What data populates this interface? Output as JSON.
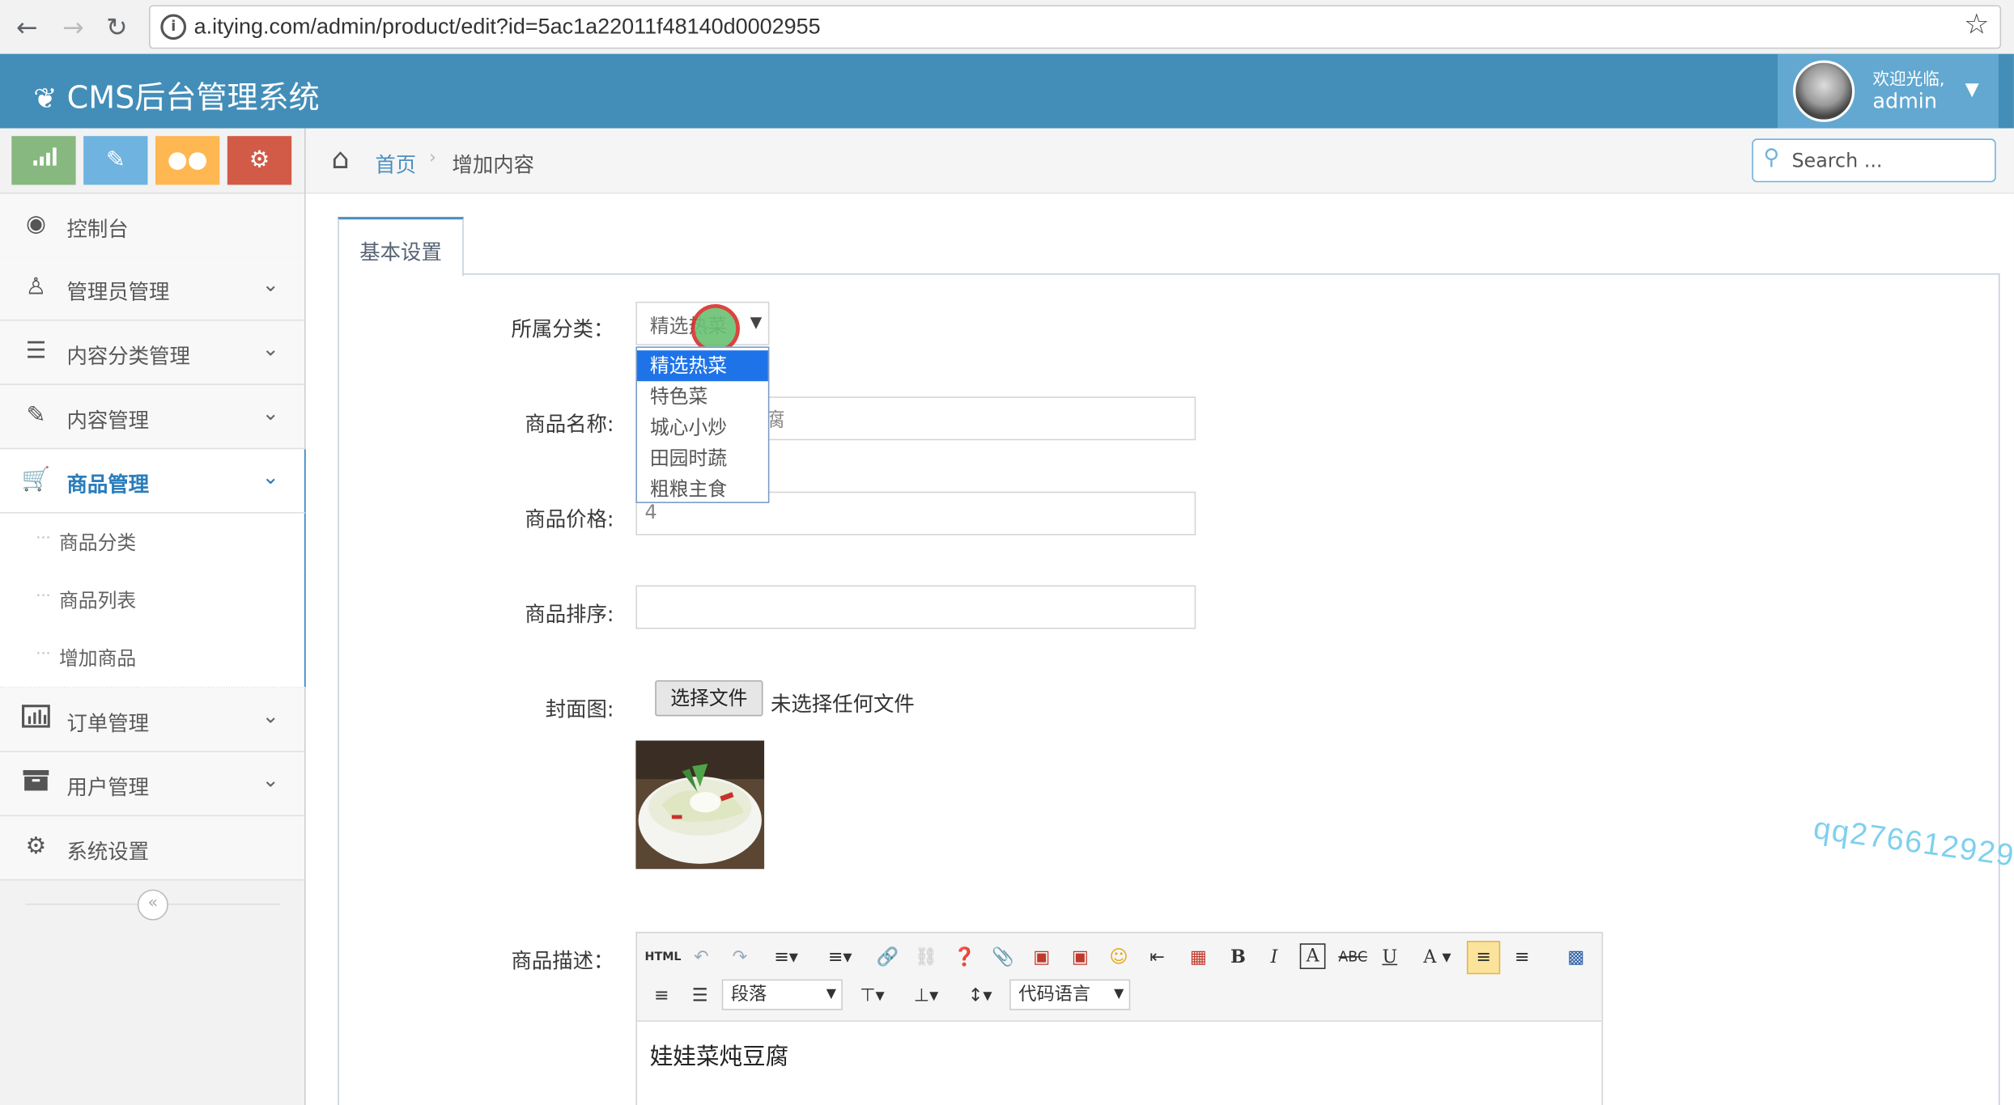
{
  "browser": {
    "url": "a.itying.com/admin/product/edit?id=5ac1a22011f48140d0002955",
    "back_icon": "arrow-left-icon",
    "forward_icon": "arrow-right-icon",
    "reload_icon": "reload-icon",
    "info_icon": "info-icon",
    "bookmark_icon": "star-icon"
  },
  "header": {
    "brand": "CMS后台管理系统",
    "welcome": "欢迎光临,",
    "username": "admin",
    "bg_color": "#438eb9"
  },
  "sidebar": {
    "shortcuts": [
      {
        "icon": "signal-icon",
        "color": "#87b87f"
      },
      {
        "icon": "pencil-icon",
        "color": "#6fb3e0"
      },
      {
        "icon": "users-icon",
        "color": "#ffb752"
      },
      {
        "icon": "cogs-icon",
        "color": "#d15b47"
      }
    ],
    "items": [
      {
        "label": "控制台",
        "icon": "dashboard-icon"
      },
      {
        "label": "管理员管理",
        "icon": "user-icon"
      },
      {
        "label": "内容分类管理",
        "icon": "list-icon"
      },
      {
        "label": "内容管理",
        "icon": "edit-icon"
      },
      {
        "label": "商品管理",
        "icon": "cart-icon",
        "active": true
      },
      {
        "label": "订单管理",
        "icon": "bar-chart-icon"
      },
      {
        "label": "用户管理",
        "icon": "archive-icon"
      },
      {
        "label": "系统设置",
        "icon": "gear-icon"
      }
    ],
    "sub_items": [
      "商品分类",
      "商品列表",
      "增加商品"
    ],
    "collapse_icon": "double-chevron-left-icon"
  },
  "breadcrumb": {
    "home": "首页",
    "current": "增加内容"
  },
  "search": {
    "placeholder": "Search ..."
  },
  "tab": {
    "label": "基本设置"
  },
  "form": {
    "category_label": "所属分类：",
    "category_value": "精选热菜",
    "category_options": [
      "精选热菜",
      "特色菜",
      "城心小炒",
      "田园时蔬",
      "粗粮主食"
    ],
    "name_label": "商品名称:",
    "name_value": "",
    "name_visible_fragment": "腐",
    "price_label": "商品价格:",
    "price_value": "4",
    "sort_label": "商品排序:",
    "sort_value": "",
    "cover_label": "封面图:",
    "file_button": "选择文件",
    "file_status": "未选择任何文件",
    "desc_label": "商品描述：",
    "desc_text": "娃娃菜炖豆腐",
    "paragraph_select": "段落",
    "code_select": "代码语言"
  },
  "watermark": "qq276612929"
}
